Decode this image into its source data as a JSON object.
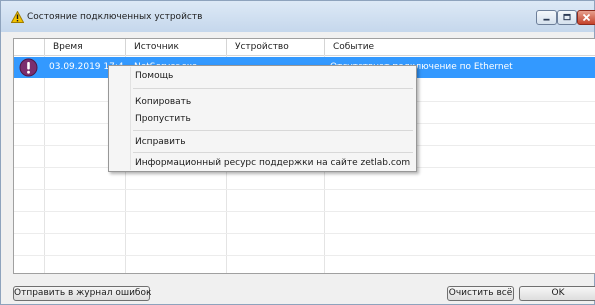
{
  "window": {
    "title": "Состояние подключенных устройств",
    "title_icon": "warning-triangle-icon",
    "controls": [
      "minimize-icon",
      "maximize-icon",
      "close-icon"
    ]
  },
  "table": {
    "columns": [
      "Время",
      "Источник",
      "Устройство",
      "Событие"
    ],
    "rows": [
      {
        "status_icon": "alert-exclamation-icon",
        "time": "03.09.2019 17:46:23",
        "source": "NetServer.exe",
        "device": "",
        "event": "Отсутствует подключение по Ethernet",
        "selected": true
      }
    ]
  },
  "context_menu": {
    "items": [
      {
        "label": "Помощь"
      },
      {
        "label": "Копировать"
      },
      {
        "label": "Пропустить"
      },
      {
        "label": "Исправить"
      },
      {
        "label": "Информационный ресурс поддержки на сайте zetlab.com"
      }
    ]
  },
  "footer": {
    "send_log_label": "Отправить в журнал ошибок",
    "clear_all_label": "Очистить всё",
    "ok_label": "OK"
  },
  "colors": {
    "selection": "#3399ff",
    "title_bar": "#d3e2f3",
    "close_button": "#c4422b",
    "alert_icon": "#7b2d6e"
  }
}
